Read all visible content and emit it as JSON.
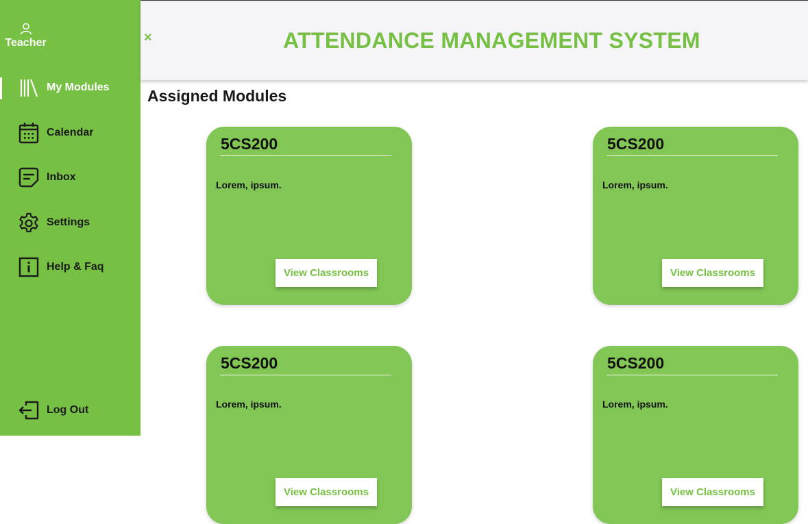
{
  "sidebar": {
    "user_label": "Teacher",
    "items": [
      {
        "label": "My Modules",
        "icon": "books-icon",
        "active": true
      },
      {
        "label": "Calendar",
        "icon": "calendar-icon"
      },
      {
        "label": "Inbox",
        "icon": "inbox-icon"
      },
      {
        "label": "Settings",
        "icon": "gear-icon"
      },
      {
        "label": "Help & Faq",
        "icon": "info-icon"
      }
    ],
    "logout_label": "Log Out"
  },
  "header": {
    "close_symbol": "×",
    "title": "ATTENDANCE MANAGEMENT SYSTEM"
  },
  "main": {
    "section_title": "Assigned Modules",
    "modules": [
      {
        "code": "5CS200",
        "description": "Lorem, ipsum.",
        "button_label": "View Classrooms"
      },
      {
        "code": "5CS200",
        "description": "Lorem, ipsum.",
        "button_label": "View Classrooms"
      },
      {
        "code": "5CS200",
        "description": "Lorem, ipsum.",
        "button_label": "View Classrooms"
      },
      {
        "code": "5CS200",
        "description": "Lorem, ipsum.",
        "button_label": "View Classrooms"
      }
    ]
  },
  "colors": {
    "brand_green": "#76c043",
    "card_green": "#82c755",
    "header_bg": "#f5f5f9"
  }
}
